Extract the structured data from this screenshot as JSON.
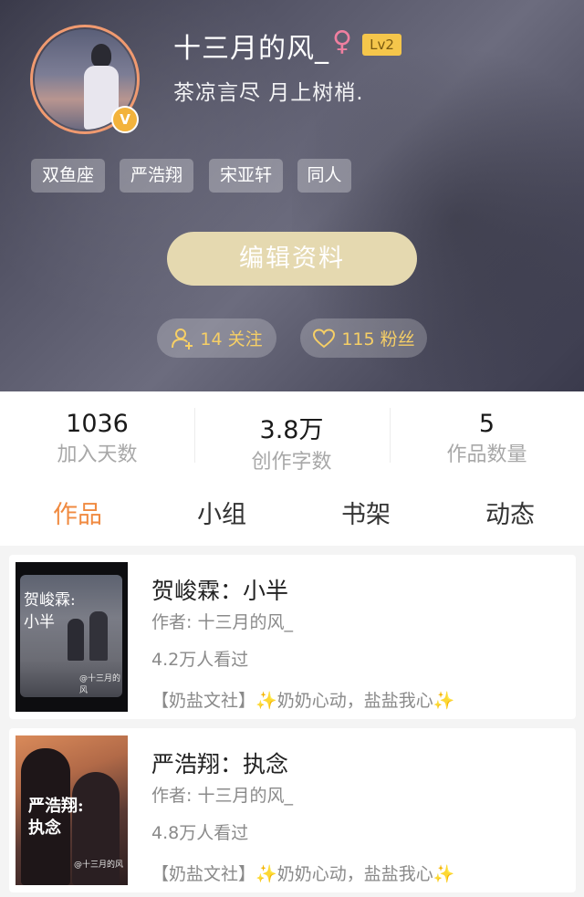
{
  "profile": {
    "nickname": "十三月的风_",
    "gender_symbol": "♀",
    "level": "Lv2",
    "verified_badge": "V",
    "signature": "茶凉言尽 月上树梢."
  },
  "tags": [
    "双鱼座",
    "严浩翔",
    "宋亚轩",
    "同人"
  ],
  "edit_button": "编辑资料",
  "follow": {
    "icon": "add-user-icon",
    "label": "14 关注"
  },
  "fans": {
    "icon": "heart-icon",
    "label": "115 粉丝"
  },
  "stats": [
    {
      "value": "1036",
      "label": "加入天数"
    },
    {
      "value": "3.8万",
      "label": "创作字数"
    },
    {
      "value": "5",
      "label": "作品数量"
    }
  ],
  "tabs": [
    "作品",
    "小组",
    "书架",
    "动态"
  ],
  "active_tab": "作品",
  "colors": {
    "accent": "#f08a40",
    "edit_button": "#e5d9b0",
    "pill_text": "#f6cf66",
    "level_badge": "#f5c64b"
  },
  "works": [
    {
      "title": "贺峻霖：小半",
      "author": "作者: 十三月的风_",
      "views": "4.2万人看过",
      "desc_prefix": "【奶盐文社】",
      "desc_sparkle": "✨",
      "desc_main": "奶奶心动，盐盐我心",
      "cover_text": [
        "贺峻霖:",
        "小半"
      ],
      "cover_credit": "@十三月的风"
    },
    {
      "title": "严浩翔：执念",
      "author": "作者: 十三月的风_",
      "views": "4.8万人看过",
      "desc_prefix": "【奶盐文社】",
      "desc_sparkle": "✨",
      "desc_main": "奶奶心动，盐盐我心",
      "cover_text": [
        "严浩翔:",
        "执念"
      ],
      "cover_credit": "@十三月的风"
    }
  ]
}
